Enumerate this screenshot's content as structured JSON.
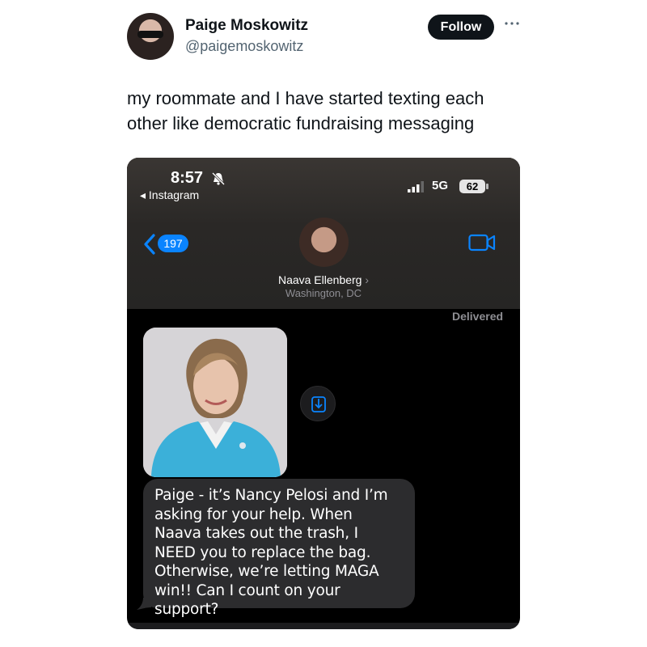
{
  "tweet": {
    "author_name": "Paige Moskowitz",
    "author_handle": "@paigemoskowitz",
    "follow_label": "Follow",
    "text": "my roommate and I have started texting each other like democratic fundraising messaging"
  },
  "phone": {
    "status_bar": {
      "time": "8:57",
      "back_app": "◂ Instagram",
      "network": "5G",
      "battery": "62"
    },
    "conversation": {
      "unread_count": "197",
      "contact_name": "Naava Ellenberg",
      "contact_location": "Washington, DC",
      "delivered_label": "Delivered",
      "message_text": "Paige - it’s Nancy Pelosi and I’m asking for your help. When Naava takes out the trash, I NEED you to replace the bag. Otherwise, we’re letting MAGA win!! Can I count on your support?"
    }
  },
  "icons": {
    "more": "more-horizontal-icon",
    "mute": "bell-slash-icon",
    "signal": "signal-bars-icon",
    "back": "chevron-left-icon",
    "video": "video-camera-icon",
    "save": "download-icon"
  },
  "colors": {
    "accent_blue": "#0a84ff",
    "bubble_gray": "#2c2c2e",
    "follow_button": "#0f1419"
  }
}
